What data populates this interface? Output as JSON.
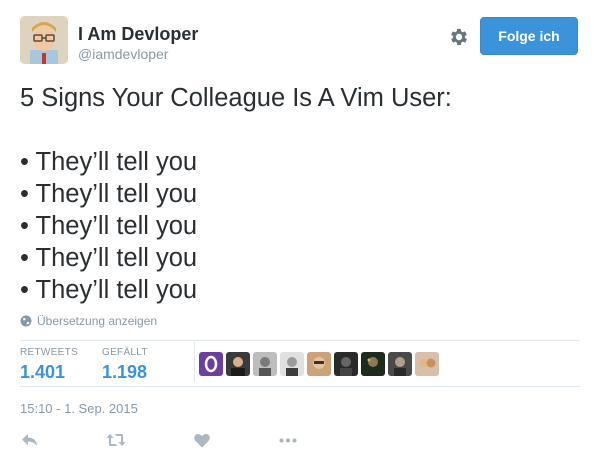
{
  "user": {
    "display_name": "I Am Devloper",
    "handle": "@iamdevloper"
  },
  "follow_button": {
    "label": "Folge ich",
    "color": "#3b94d9"
  },
  "tweet": {
    "title": "5 Signs Your Colleague Is A Vim User:",
    "bullets": [
      "• They’ll tell you",
      "• They’ll tell you",
      "• They’ll tell you",
      "• They’ll tell you",
      "• They’ll tell you"
    ]
  },
  "translate_label": "Übersetzung anzeigen",
  "stats": {
    "retweets_label": "RETWEETS",
    "retweets_value": "1.401",
    "likes_label": "GEFÄLLT",
    "likes_value": "1.198"
  },
  "timestamp": "15:10 - 1. Sep. 2015",
  "icons": {
    "settings": "gear-icon",
    "translate": "globe-icon",
    "reply": "reply-icon",
    "retweet": "retweet-icon",
    "like": "heart-icon",
    "more": "more-icon"
  },
  "colors": {
    "text": "#292f33",
    "muted": "#8899a6",
    "link": "#3b94d9",
    "divider": "#e1e8ed",
    "action_icon": "#aab8c2"
  },
  "liker_avatar_count": 9
}
